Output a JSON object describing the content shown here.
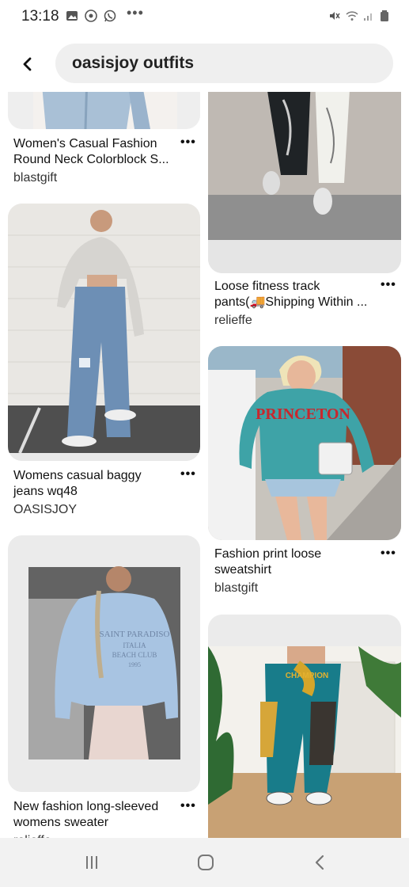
{
  "status_bar": {
    "time": "13:18",
    "left_icons": [
      "gallery-icon",
      "settings-notif-icon",
      "whatsapp-icon"
    ],
    "overflow": "•••",
    "right_icons": [
      "mute-icon",
      "wifi-icon",
      "signal-icon",
      "battery-icon"
    ]
  },
  "search": {
    "query": "oasisjoy outfits"
  },
  "pins": [
    {
      "title": "Women's Casual Fashion\nRound Neck Colorblock S...",
      "source": "blastgift",
      "more": "•••"
    },
    {
      "title": "Loose fitness track\npants(🚚Shipping Within ...",
      "source": "relieffe",
      "more": "•••"
    },
    {
      "title": "Womens casual baggy\njeans wq48",
      "source": "OASISJOY",
      "more": "•••"
    },
    {
      "title": "Fashion print loose\nsweatshirt",
      "source": "blastgift",
      "more": "•••"
    },
    {
      "title": "New fashion long-sleeved\nwomens sweater",
      "source": "relieffe",
      "more": "•••"
    }
  ],
  "image_labels": {
    "princeton": "PRINCETON",
    "saint_paradiso": "SAINT PARADISO",
    "italia": "ITALIA",
    "beach_club": "BEACH CLUB",
    "year": "1995",
    "pants_print": "CHAMPION"
  },
  "nav": {
    "items": [
      "recents-icon",
      "home-icon",
      "back-icon"
    ]
  },
  "colors": {
    "search_bg": "#efefef",
    "card_bg": "#e9e9e9",
    "navbar_bg": "#f2f2f2"
  }
}
